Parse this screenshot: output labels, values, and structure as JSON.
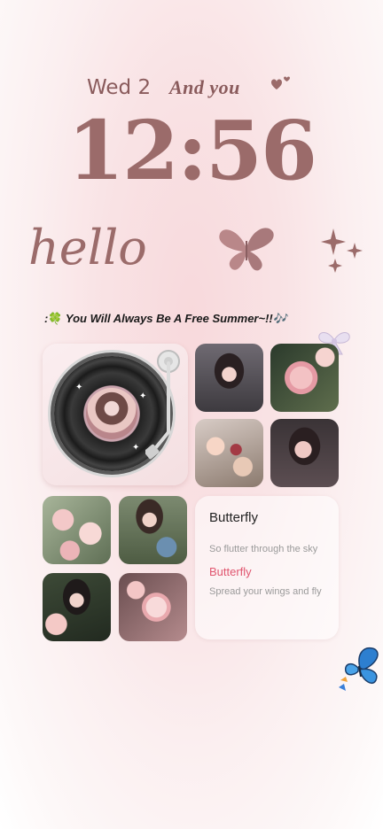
{
  "lockscreen": {
    "date": "Wed 2",
    "tagline": "And you",
    "time": "12:56",
    "greeting": "hello"
  },
  "widgets": {
    "caption_prefix": ":",
    "caption_emoji": "🍀",
    "caption_text": "You Will Always Be A Free Summer~!!",
    "caption_suffix": "🎶",
    "lyrics": {
      "title": "Butterfly",
      "line1": "So flutter through the sky",
      "line2": "Butterfly",
      "line3": "Spread your wings and fly"
    }
  },
  "colors": {
    "clock": "#9b6b6a",
    "accent_lyric": "#e0566f"
  },
  "icons": [
    "heart-icon",
    "butterfly-icon",
    "sparkle-icon",
    "ribbon-icon",
    "vinyl-record-icon",
    "tonearm-icon",
    "blue-butterfly-icon"
  ]
}
